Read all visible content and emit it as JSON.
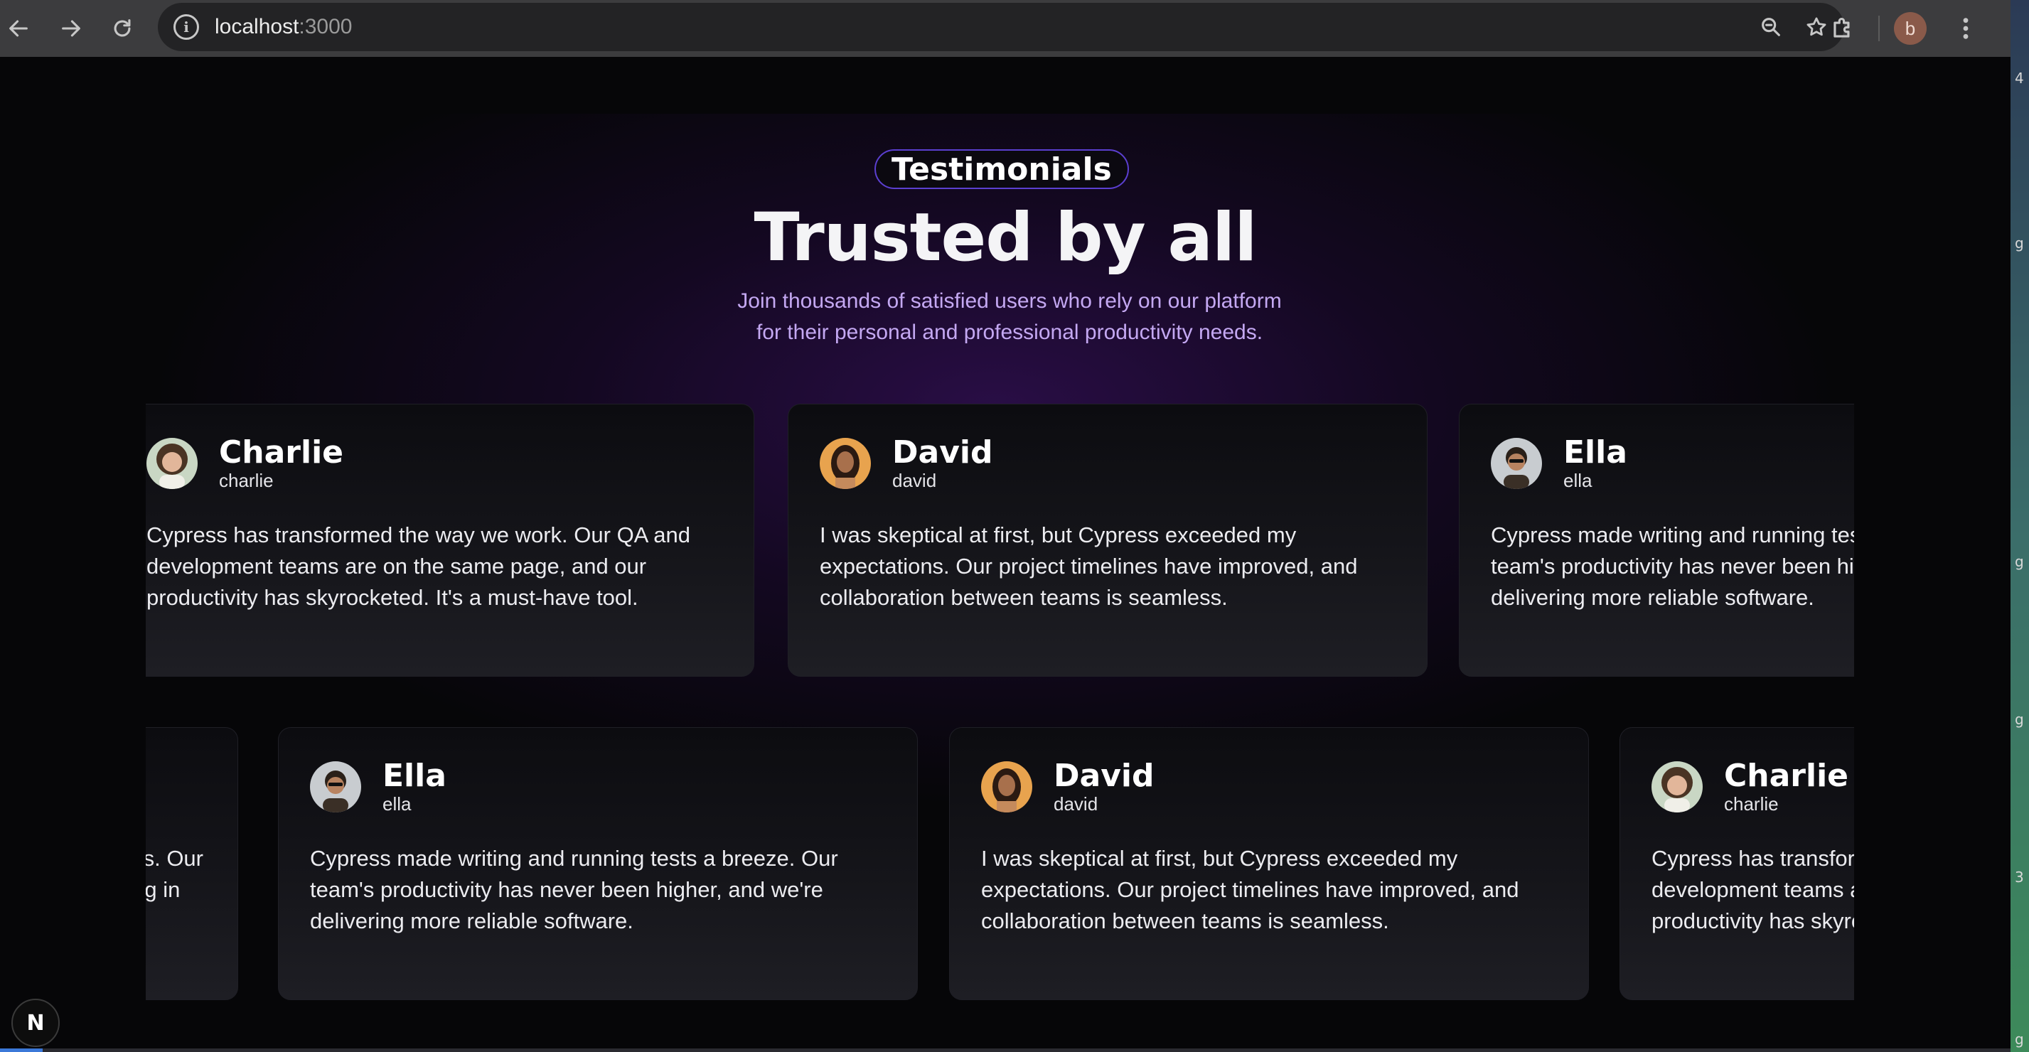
{
  "browser": {
    "url_host": "localhost",
    "url_port": ":3000",
    "profile_initial": "b",
    "back_icon": "arrow-left-icon",
    "forward_icon": "arrow-right-icon",
    "reload_icon": "reload-icon"
  },
  "hero": {
    "badge": "Testimonials",
    "title": "Trusted by all",
    "subtitle_line1": "Join thousands of satisfied users who rely on our platform",
    "subtitle_line2": "for their personal and professional productivity needs."
  },
  "row1": [
    {
      "name": "Charlie",
      "handle": "charlie",
      "quote": "Cypress has transformed the way we work. Our QA and development teams are on the same page, and our productivity has skyrocketed. It's a must-have tool."
    },
    {
      "name": "David",
      "handle": "david",
      "quote": "I was skeptical at first, but Cypress exceeded my expectations. Our project timelines have improved, and collaboration between teams is seamless."
    },
    {
      "name": "Ella",
      "handle": "ella",
      "quote": "Cypress made writing and running tests a breeze. Our team's productivity has never been higher, and we're delivering more reliable software."
    }
  ],
  "row2": [
    {
      "quote_fragment_line1": "ks. Our",
      "quote_fragment_line2": "ng in"
    },
    {
      "name": "Ella",
      "handle": "ella",
      "quote": "Cypress made writing and running tests a breeze. Our team's productivity has never been higher, and we're delivering more reliable software."
    },
    {
      "name": "David",
      "handle": "david",
      "quote": "I was skeptical at first, but Cypress exceeded my expectations. Our project timelines have improved, and collaboration between teams is seamless."
    },
    {
      "name": "Charlie",
      "handle": "charlie",
      "quote": "Cypress has transformed the way we work. Our QA and development teams are on the same page, and our productivity has skyrocketed. It's a must-have tool."
    }
  ],
  "dev_indicator": {
    "label": "N"
  },
  "side_strip_letters": [
    "4",
    "g",
    "g",
    "g",
    "3",
    "g"
  ],
  "colors": {
    "badge_border": "#5b3fd0",
    "subtitle": "#c4a8f2",
    "page_bg": "#060608"
  }
}
